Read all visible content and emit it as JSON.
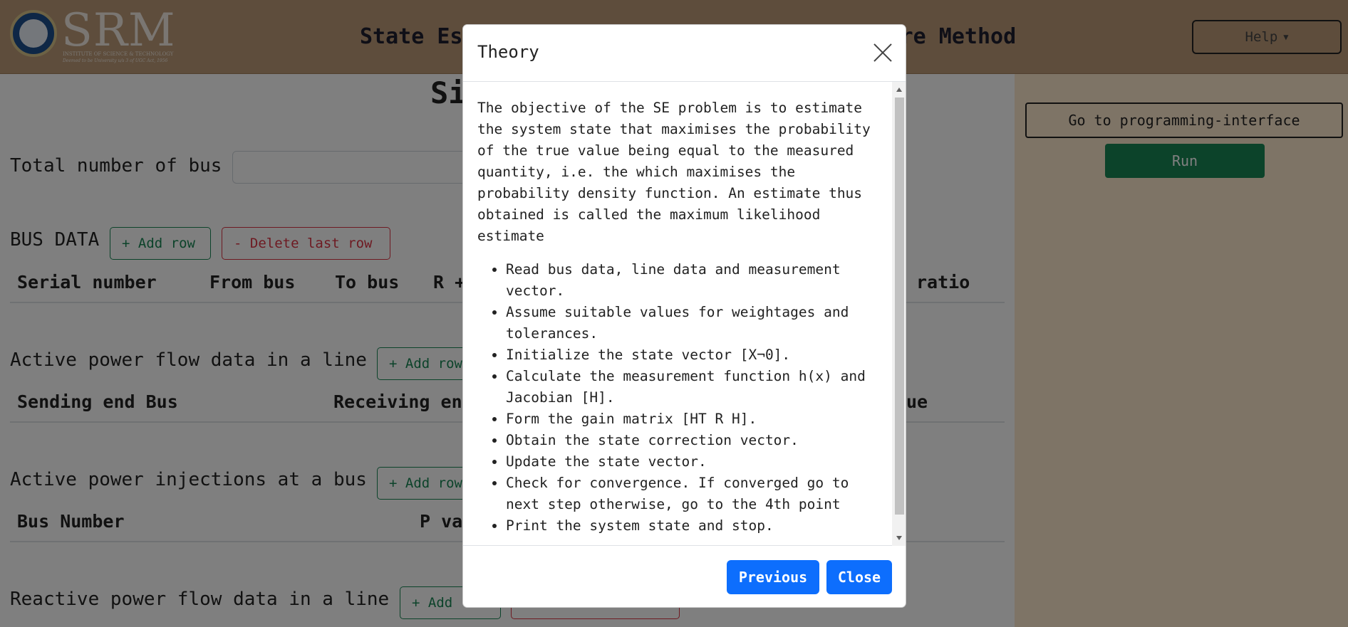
{
  "header": {
    "logo_text": "SRM",
    "logo_subtitle": "INSTITUTE OF SCIENCE & TECHNOLOGY",
    "logo_tagline": "Deemed to be University u/s 3 of UGC Act, 1956",
    "title": "State Estimation using Weighted Least Square Method",
    "help_label": "Help"
  },
  "main": {
    "sim_title": "Simulation",
    "total_bus_label": "Total number of bus",
    "bus_data": {
      "label": "BUS DATA",
      "add_label": "+ Add row",
      "delete_label": "- Delete last row",
      "columns": [
        "Serial number",
        "From bus",
        "To bus",
        "R +",
        "ratio"
      ]
    },
    "active_flow": {
      "label": "Active power flow data in a line",
      "add_label": "+ Add row",
      "columns": [
        "Sending end Bus",
        "Receiving en",
        "ue"
      ]
    },
    "active_injection": {
      "label": "Active power injections at a bus",
      "add_label": "+ Add row",
      "columns": [
        "Bus Number",
        "P va"
      ]
    },
    "reactive_flow": {
      "label": "Reactive power flow data in a line",
      "add_label": "+ Add"
    }
  },
  "right_panel": {
    "goto_label": "Go to programming-interface",
    "run_label": "Run"
  },
  "modal": {
    "title": "Theory",
    "paragraph": "The objective of the SE problem is to estimate the system state that maximises the probability of the true value being equal to the measured quantity, i.e. the which maximises the probability density function. An estimate thus obtained is called the maximum likelihood estimate",
    "steps": [
      "Read bus data, line data and measurement vector.",
      "Assume suitable values for weightages and tolerances.",
      "Initialize the state vector [X¬0].",
      "Calculate the measurement function h(x) and Jacobian [H].",
      "Form the gain matrix [HT R H].",
      "Obtain the state correction vector.",
      "Update the state vector.",
      "Check for convergence. If converged go to next step otherwise, go to the 4th point",
      "Print the system state and stop."
    ],
    "previous_label": "Previous",
    "close_label": "Close"
  }
}
